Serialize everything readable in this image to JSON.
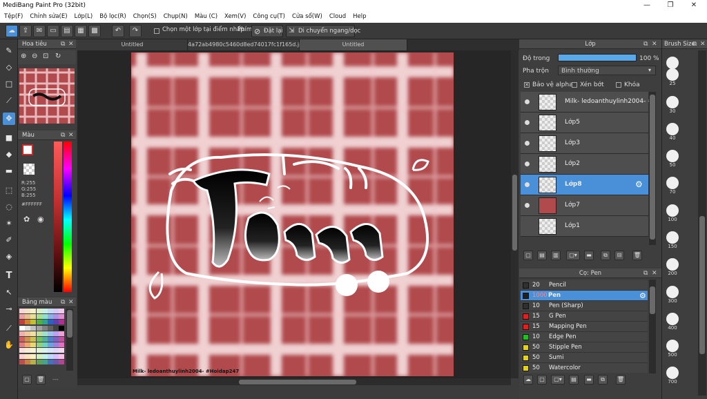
{
  "window": {
    "title": "MediBang Paint Pro (32bit)"
  },
  "menu": [
    "Tệp(F)",
    "Chỉnh sửa(E)",
    "Lớp(L)",
    "Bộ lọc(R)",
    "Chọn(S)",
    "Chụp(N)",
    "Màu (C)",
    "Xem(V)",
    "Công cụ(T)",
    "Cửa sổ(W)",
    "Cloud",
    "Help"
  ],
  "toolbar": {
    "select_layer_label": "Chọn một lớp tại điểm nhấp",
    "key_label": "Phím",
    "reset_label": "Đặt lại",
    "move_label": "Di chuyển ngang/dọc"
  },
  "tabs": [
    "Untitled",
    "4a72ab4980c5460d8ed74017fc1f165d.jpg",
    "Untitled"
  ],
  "navigator": {
    "title": "Hoa tiêu"
  },
  "color": {
    "title": "Màu",
    "r": "R:255",
    "g": "G:255",
    "b": "B:255",
    "hex": "#FFFFFF"
  },
  "palette": {
    "title": "Bảng màu",
    "dash": "---"
  },
  "layers": {
    "title": "Lớp",
    "opacity_label": "Độ trong",
    "opacity_value": "100 %",
    "blend_label": "Pha trộn",
    "blend_value": "Bình thường",
    "protect_alpha": "Bảo vệ alpha",
    "clip": "Xén bớt",
    "lock": "Khóa",
    "items": [
      {
        "name": "Milk- ledoanthuylinh2004- #"
      },
      {
        "name": "Lớp5"
      },
      {
        "name": "Lớp3"
      },
      {
        "name": "Lớp2"
      },
      {
        "name": "Lớp8"
      },
      {
        "name": "Lớp7"
      },
      {
        "name": "Lớp1"
      }
    ]
  },
  "brushes": {
    "title": "Cọ: Pen",
    "items": [
      {
        "size": "20",
        "name": "Pencil",
        "color": "#303030"
      },
      {
        "size": "1000",
        "name": "Pen",
        "color": "#202020"
      },
      {
        "size": "10",
        "name": "Pen (Sharp)",
        "color": "#303030"
      },
      {
        "size": "15",
        "name": "G Pen",
        "color": "#e02020"
      },
      {
        "size": "15",
        "name": "Mapping Pen",
        "color": "#e02020"
      },
      {
        "size": "10",
        "name": "Edge Pen",
        "color": "#20c020"
      },
      {
        "size": "50",
        "name": "Stipple Pen",
        "color": "#e0d020"
      },
      {
        "size": "50",
        "name": "Sumi",
        "color": "#e0d020"
      },
      {
        "size": "50",
        "name": "Watercolor",
        "color": "#e0d020"
      }
    ]
  },
  "brush_size": {
    "title": "Brush Size",
    "sizes": [
      "20",
      "25",
      "30",
      "40",
      "50",
      "70",
      "100",
      "150",
      "200",
      "300",
      "400",
      "500",
      "700"
    ]
  },
  "canvas": {
    "caption": "Milk- ledoanthuylinh2004- #Hoidap247",
    "text": "Tầm"
  }
}
